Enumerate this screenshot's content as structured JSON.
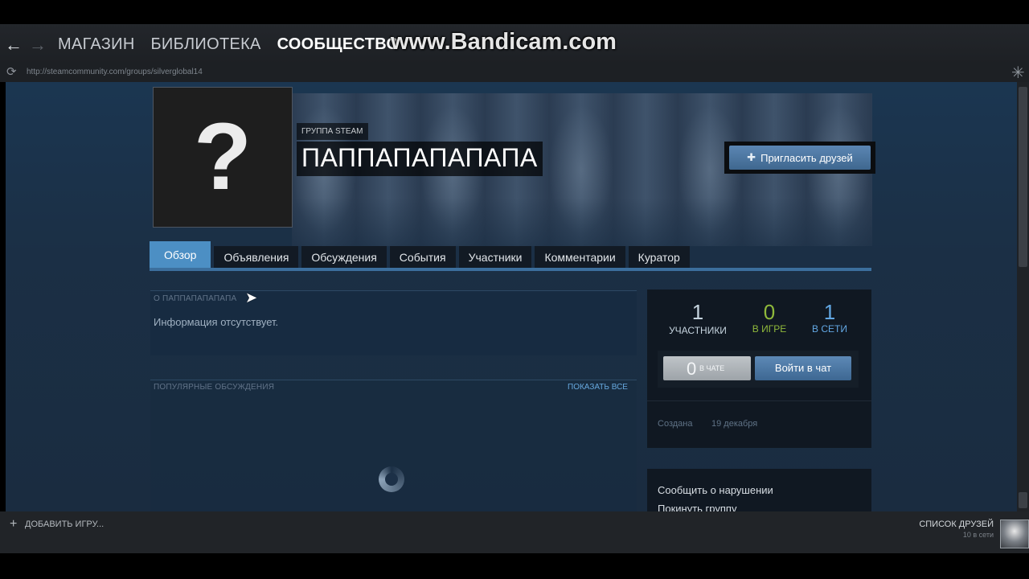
{
  "topbar": {
    "nav": [
      "МАГАЗИН",
      "БИБЛИОТЕКА",
      "СООБЩЕСТВО"
    ],
    "active_index": 2,
    "watermark": "www.Bandicam.com",
    "url": "http://steamcommunity.com/groups/silverglobal14"
  },
  "group": {
    "type_label": "ГРУППА STEAM",
    "name": "ПАППАПАПАПАПА",
    "avatar_placeholder": "?",
    "invite_label": "Пригласить друзей"
  },
  "tabs": [
    "Обзор",
    "Объявления",
    "Обсуждения",
    "События",
    "Участники",
    "Комментарии",
    "Куратор"
  ],
  "about": {
    "heading": "О ПАППАПАПАПАПА",
    "text": "Информация отсутствует."
  },
  "popular": {
    "heading": "ПОПУЛЯРНЫЕ ОБСУЖДЕНИЯ",
    "show_all": "ПОКАЗАТЬ ВСЕ"
  },
  "stats": {
    "members": {
      "value": "1",
      "label": "УЧАСТНИКИ",
      "color": "#c6d4df"
    },
    "in_game": {
      "value": "0",
      "label": "В ИГРЕ",
      "color": "#8fb93b"
    },
    "online": {
      "value": "1",
      "label": "В СЕТИ",
      "color": "#62a7e3"
    },
    "chat_count": "0",
    "chat_label": "В ЧАТЕ",
    "join_chat": "Войти в чат",
    "created_label": "Создана",
    "created_value": "19 декабря"
  },
  "links": [
    "Сообщить о нарушении",
    "Покинуть группу"
  ],
  "bottombar": {
    "add_game": "ДОБАВИТЬ ИГРУ...",
    "friends_list": "СПИСОК ДРУЗЕЙ",
    "friends_online": "10 в сети"
  }
}
